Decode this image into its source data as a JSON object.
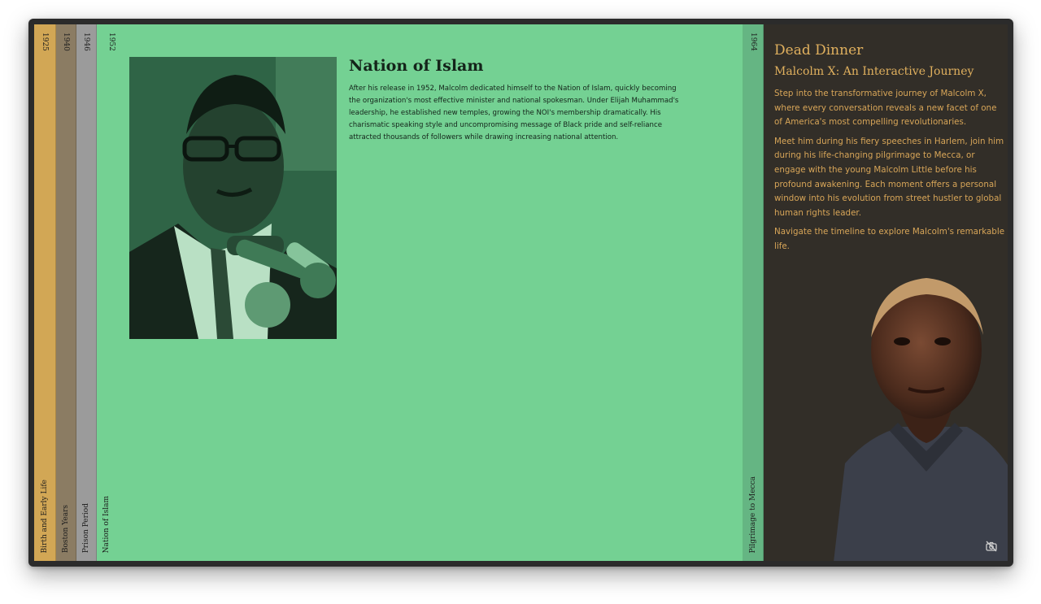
{
  "timeline": {
    "strips": [
      {
        "year": "1925",
        "label": "Birth and Early Life",
        "color": "#d2a755"
      },
      {
        "year": "1940",
        "label": "Boston Years",
        "color": "#8b7c63"
      },
      {
        "year": "1946",
        "label": "Prison Period",
        "color": "#9b9b9b"
      }
    ],
    "active": {
      "year": "1952",
      "label": "Nation of Islam",
      "color": "#74d193"
    },
    "after": {
      "year": "1964",
      "label": "Pilgrimage to Mecca",
      "color": "#65b583"
    }
  },
  "article": {
    "heading": "Nation of Islam",
    "body": "After his release in 1952, Malcolm dedicated himself to the Nation of Islam, quickly becoming the organization's most effective minister and national spokesman. Under Elijah Muhammad's leadership, he established new temples, growing the NOI's membership dramatically. His charismatic speaking style and uncompromising message of Black pride and self-reliance attracted thousands of followers while drawing increasing national attention."
  },
  "intro": {
    "app_title": "Dead Dinner",
    "subtitle": "Malcolm X: An Interactive Journey",
    "paragraphs": [
      "Step into the transformative journey of Malcolm X, where every conversation reveals a new facet of one of America's most compelling revolutionaries.",
      "Meet him during his fiery speeches in Harlem, join him during his life-changing pilgrimage to Mecca, or engage with the young Malcolm Little before his profound awakening. Each moment offers a personal window into his evolution from street hustler to global human rights leader.",
      "Navigate the timeline to explore Malcolm's remarkable life."
    ]
  },
  "icons": {
    "camera_toggle": "camera-off-icon"
  },
  "colors": {
    "accent": "#e0b05e",
    "panel_dark": "#322e28",
    "active_green": "#74d193"
  }
}
